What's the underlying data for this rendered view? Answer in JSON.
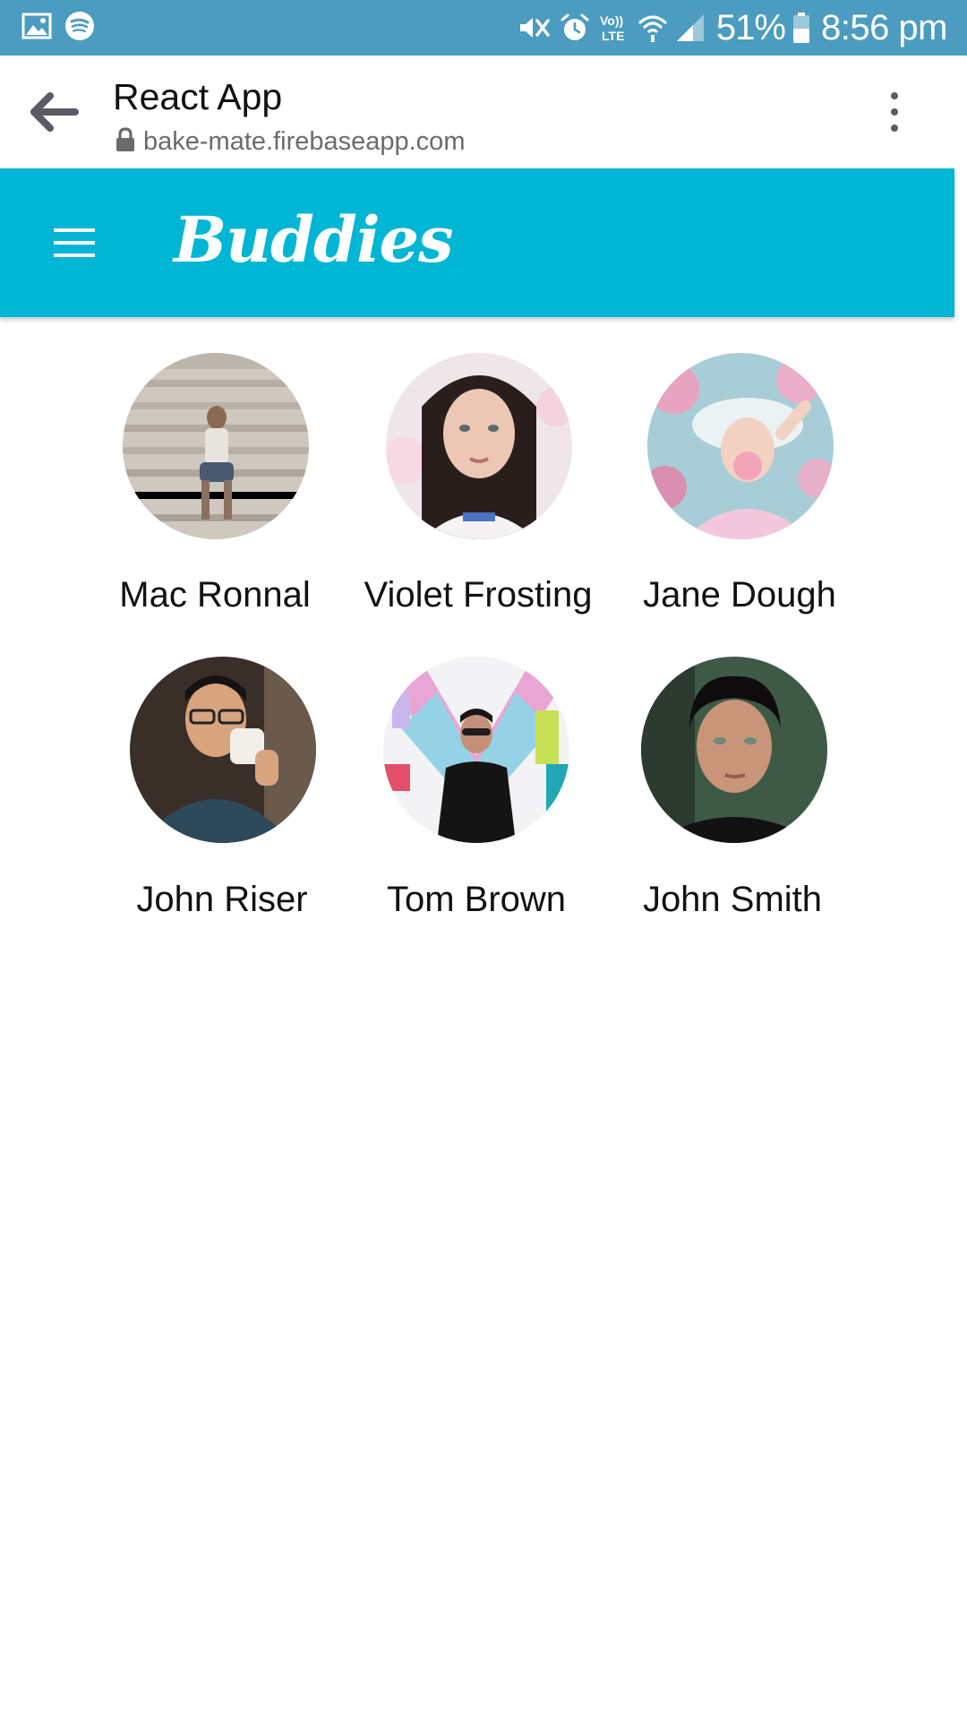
{
  "status_bar": {
    "battery": "51%",
    "time": "8:56 pm",
    "network_label_top": "Vo))",
    "network_label_bottom": "LTE",
    "icons": [
      "gallery-icon",
      "spotify-icon",
      "vibrate-icon",
      "alarm-icon",
      "volte-icon",
      "wifi-icon",
      "signal-icon",
      "battery-icon"
    ]
  },
  "browser": {
    "page_title": "React App",
    "url": "bake-mate.firebaseapp.com",
    "icons": [
      "back-arrow-icon",
      "lock-icon",
      "overflow-menu-icon"
    ]
  },
  "app_bar": {
    "title": "Buddies",
    "background_color": "#00b6d4",
    "icons": [
      "hamburger-menu-icon"
    ]
  },
  "buddies": [
    {
      "name": "Mac Ronnal"
    },
    {
      "name": "Violet Frosting"
    },
    {
      "name": "Jane Dough"
    },
    {
      "name": "John Riser"
    },
    {
      "name": "Tom Brown"
    },
    {
      "name": "John Smith"
    }
  ]
}
